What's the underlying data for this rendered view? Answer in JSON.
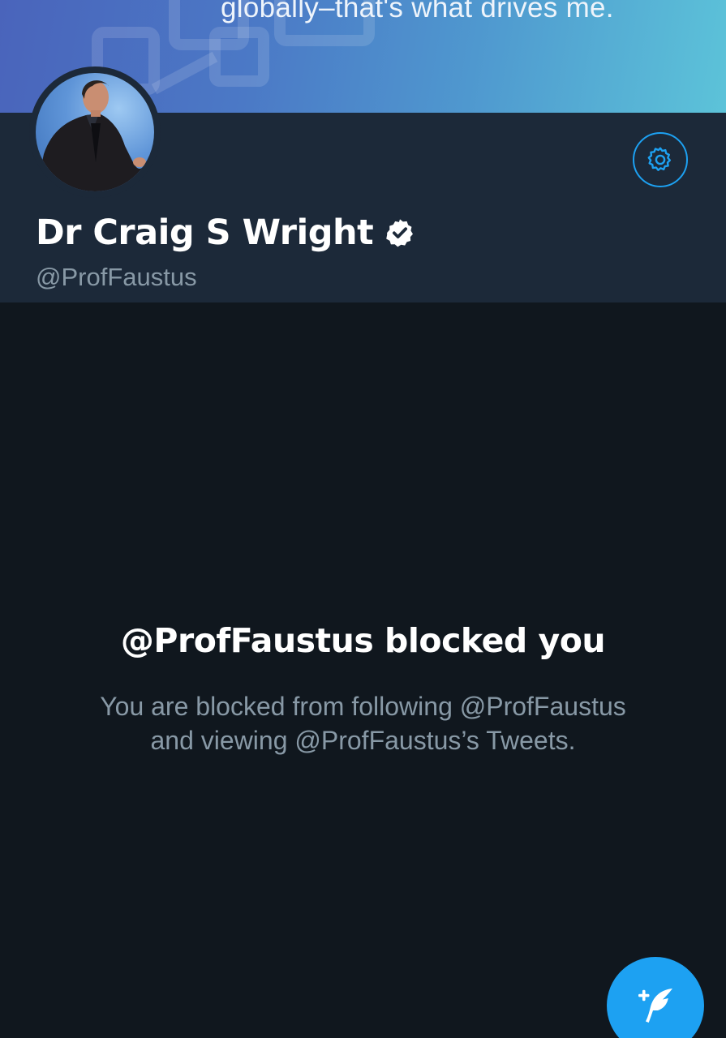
{
  "banner": {
    "text": "globally–that's what drives me."
  },
  "profile": {
    "name": "Dr Craig S Wright",
    "handle": "@ProfFaustus",
    "verified": true
  },
  "blocked": {
    "title": "@ProfFaustus blocked you",
    "line1": "You are blocked from following @ProfFaustus",
    "line2": "and viewing @ProfFaustus’s Tweets."
  },
  "icons": {
    "settings": "gear-icon",
    "verified": "verified-badge-icon",
    "compose": "compose-tweet-icon"
  },
  "colors": {
    "accent": "#1da1f2",
    "background": "#10171e",
    "header_bg": "#1c2939",
    "secondary_text": "#8899a6"
  }
}
